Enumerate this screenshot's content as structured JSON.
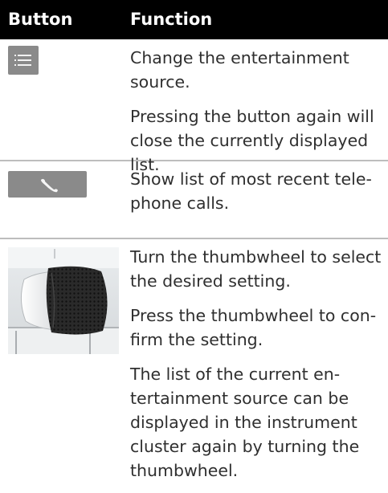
{
  "header": {
    "col_button": "Button",
    "col_function": "Function"
  },
  "rows": [
    {
      "icon": "list-icon",
      "paragraphs": [
        "Change the entertainment source.",
        "Pressing the button again will close the currently displayed list."
      ]
    },
    {
      "icon": "phone-icon",
      "paragraphs": [
        "Show list of most recent tele-phone calls."
      ]
    },
    {
      "icon": "thumbwheel-image",
      "paragraphs": [
        "Turn the thumbwheel to select the desired setting.",
        "Press the thumbwheel to con-firm the setting.",
        "The list of the current en-tertainment source can be displayed in the instrument cluster again by turning the thumbwheel."
      ]
    }
  ]
}
